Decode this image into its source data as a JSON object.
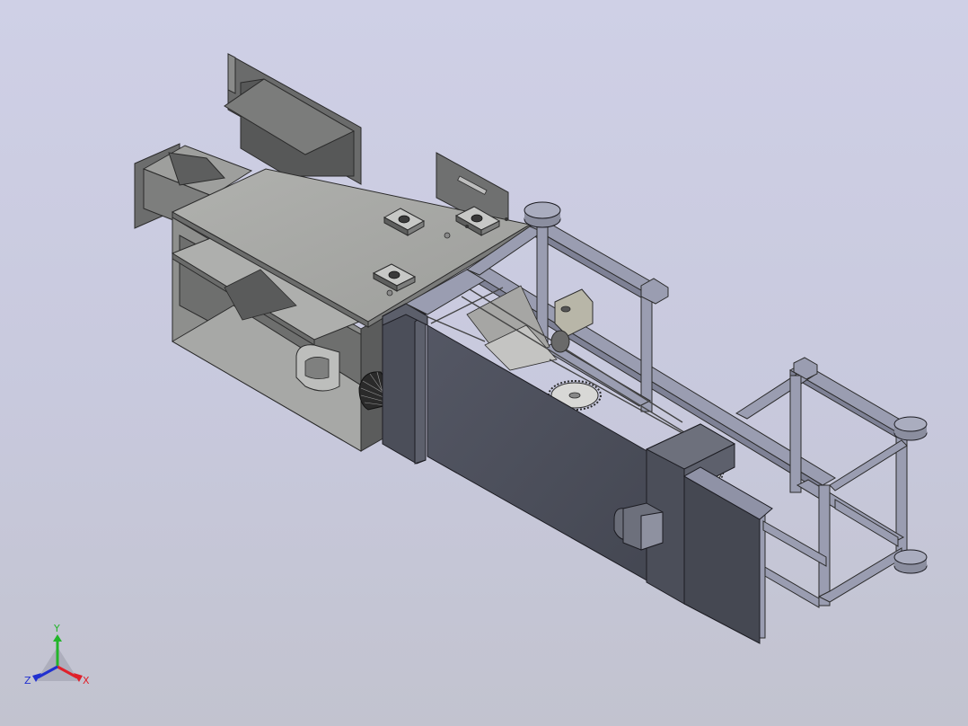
{
  "triad": {
    "x_label": "X",
    "y_label": "Y",
    "z_label": "Z",
    "x_color": "#e0202a",
    "y_color": "#22b52a",
    "z_color": "#2030d0"
  },
  "colors": {
    "background_top": "#cfd0e6",
    "background_bottom": "#c2c3cf",
    "steel_light": "#a9aaa8",
    "steel_mid": "#8b8c8b",
    "steel_dark": "#5c5d5d",
    "panel_blue": "#4c4f5a",
    "frame_blue": "#9a9db1"
  }
}
